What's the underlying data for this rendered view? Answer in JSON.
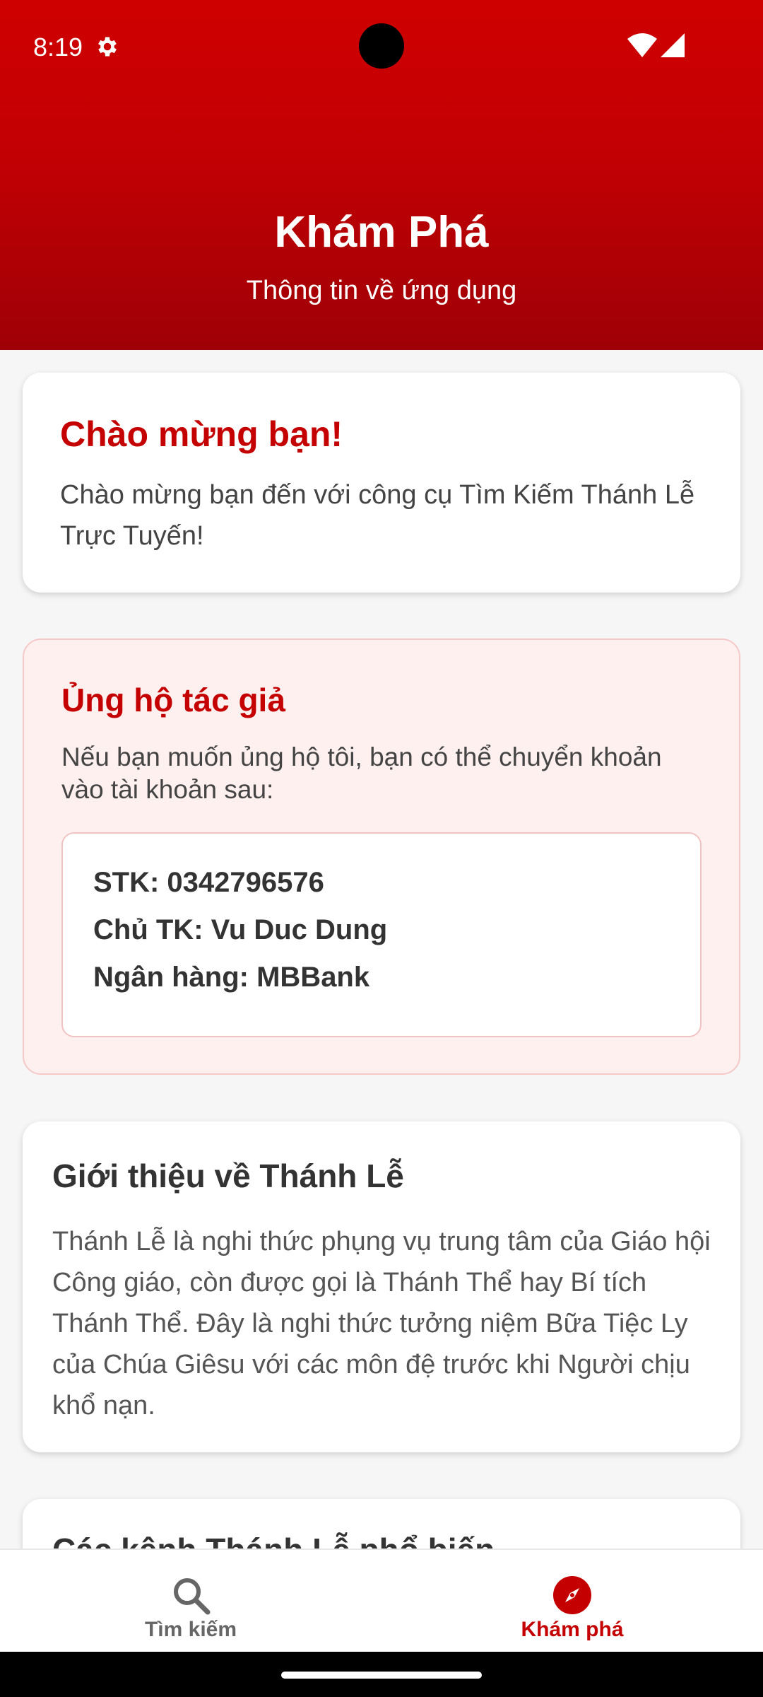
{
  "status_bar": {
    "time": "8:19",
    "icons": [
      "gear-icon",
      "wifi-icon",
      "signal-icon"
    ]
  },
  "header": {
    "title": "Khám Phá",
    "subtitle": "Thông tin về ứng dụng",
    "gradient_colors": [
      "#cf0000",
      "#9e0006"
    ]
  },
  "welcome": {
    "title": "Chào mừng bạn!",
    "text": "Chào mừng bạn đến với công cụ Tìm Kiếm Thánh Lễ Trực Tuyến!"
  },
  "support": {
    "title": "Ủng hộ tác giả",
    "text": "Nếu bạn muốn ủng hộ tôi, bạn có thể chuyển khoản vào tài khoản sau:",
    "account_number": "STK: 0342796576",
    "account_holder": "Chủ TK: Vu Duc Dung",
    "bank": "Ngân hàng: MBBank"
  },
  "intro": {
    "title": "Giới thiệu về Thánh Lễ",
    "text": "Thánh Lễ là nghi thức phụng vụ trung tâm của Giáo hội Công giáo, còn được gọi là Thánh Thể hay Bí tích Thánh Thể. Đây là nghi thức tưởng niệm Bữa Tiệc Ly của Chúa Giêsu với các môn đệ trước khi Người chịu khổ nạn."
  },
  "channels": {
    "title": "Các kênh Thánh Lễ phổ biến"
  },
  "bottom_nav": {
    "items": [
      {
        "label": "Tìm kiếm",
        "icon": "search-icon",
        "active": false
      },
      {
        "label": "Khám phá",
        "icon": "compass-icon",
        "active": true
      }
    ]
  },
  "colors": {
    "accent": "#c40000",
    "support_bg": "#fff0f0",
    "support_border": "#f6c8c8"
  }
}
